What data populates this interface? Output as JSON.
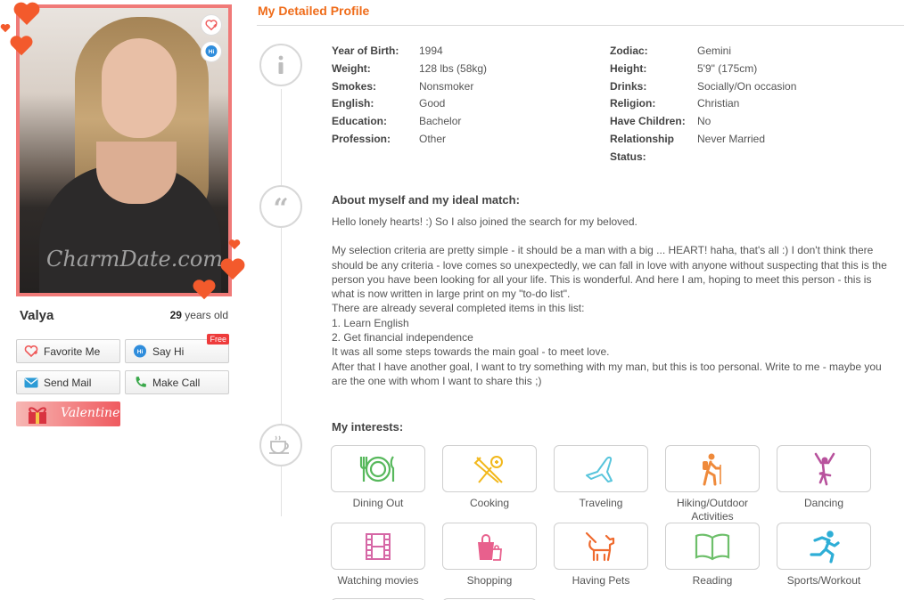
{
  "profile": {
    "name": "Valya",
    "age": "29",
    "age_suffix": " years old",
    "watermark": "CharmDate.com",
    "badge_hi": "Hi"
  },
  "actions": {
    "favorite": "Favorite Me",
    "say_hi": "Say Hi",
    "free_badge": "Free",
    "send_mail": "Send Mail",
    "make_call": "Make Call",
    "valentine": "Valentine"
  },
  "section_title": "My Detailed Profile",
  "details_left": [
    {
      "label": "Year of Birth:",
      "value": "1994"
    },
    {
      "label": "Weight:",
      "value": "128 lbs (58kg)"
    },
    {
      "label": "Smokes:",
      "value": "Nonsmoker"
    },
    {
      "label": "English:",
      "value": "Good"
    },
    {
      "label": "Education:",
      "value": "Bachelor"
    },
    {
      "label": "Profession:",
      "value": "Other"
    }
  ],
  "details_right": [
    {
      "label": "Zodiac:",
      "value": "Gemini"
    },
    {
      "label": "Height:",
      "value": "5'9\" (175cm)"
    },
    {
      "label": "Drinks:",
      "value": "Socially/On occasion"
    },
    {
      "label": "Religion:",
      "value": "Christian"
    },
    {
      "label": "Have Children:",
      "value": "No"
    },
    {
      "label": "Relationship",
      "label2": "Status:",
      "value": "Never Married"
    }
  ],
  "about": {
    "title": "About myself and my ideal match:",
    "lines": [
      "Hello lonely hearts! :) So I also joined the search for my beloved.",
      "",
      "My selection criteria are pretty simple - it should be a man with a big ... HEART! haha, that's all :) I don't think there should be any criteria - love comes so unexpectedly, we can fall in love with anyone without suspecting that this is the person you have been looking for all your life. This is wonderful. And here I am, hoping to meet this person - this is what is now written in large print on my \"to-do list\".",
      "There are already several completed items in this list:",
      "1. Learn English",
      "2. Get financial independence",
      "It was all some steps towards the main goal - to meet love.",
      "After that I have another goal, I want to try something with my man, but this is too personal. Write to me - maybe you are the one with whom I want to share this ;)"
    ]
  },
  "interests": {
    "title": "My interests:",
    "items": [
      {
        "label": "Dining Out",
        "icon": "dining-icon",
        "color": "#57b85c"
      },
      {
        "label": "Cooking",
        "icon": "cooking-icon",
        "color": "#f2b81c"
      },
      {
        "label": "Traveling",
        "icon": "plane-icon",
        "color": "#58c5dc"
      },
      {
        "label": "Hiking/Outdoor Activities",
        "icon": "hiking-icon",
        "color": "#ef8a3b"
      },
      {
        "label": "Dancing",
        "icon": "dancing-icon",
        "color": "#b8529d"
      },
      {
        "label": "Watching movies",
        "icon": "film-icon",
        "color": "#d668a6"
      },
      {
        "label": "Shopping",
        "icon": "shopping-bag-icon",
        "color": "#e8608d"
      },
      {
        "label": "Having Pets",
        "icon": "pet-icon",
        "color": "#ef6a2e"
      },
      {
        "label": "Reading",
        "icon": "book-icon",
        "color": "#6dbf6a"
      },
      {
        "label": "Sports/Workout",
        "icon": "running-icon",
        "color": "#2eaed6"
      }
    ]
  },
  "colors": {
    "accent": "#ef6c1a",
    "frame": "#f07a78",
    "free_badge": "#ee3b3b"
  }
}
